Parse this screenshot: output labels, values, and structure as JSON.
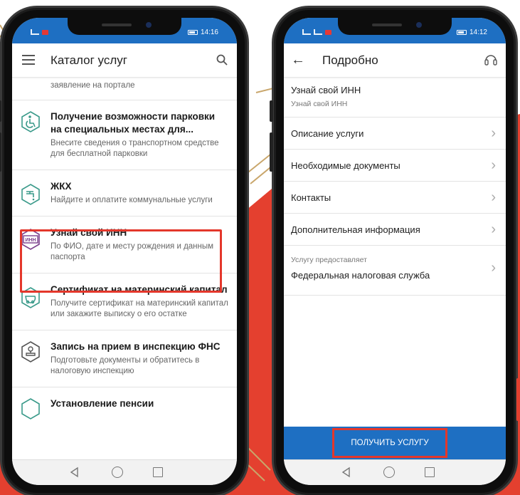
{
  "colors": {
    "accent_blue": "#1e6fc2",
    "highlight_red": "#e4372b",
    "background_red": "#e4402f",
    "gold_lines": "#c9a66b"
  },
  "left_phone": {
    "status": {
      "time": "14:16"
    },
    "appbar": {
      "title": "Каталог услуг",
      "menu_icon": "menu-icon",
      "search_icon": "search-icon"
    },
    "partial_top_text": "заявление на портале",
    "services": [
      {
        "icon": "wheelchair-icon",
        "title": "Получение возможности парковки на специальных местах для...",
        "desc": "Внесите сведения о транспортном средстве для бесплатной парковки"
      },
      {
        "icon": "faucet-icon",
        "title": "ЖКХ",
        "desc": "Найдите и оплатите коммунальные услуги"
      },
      {
        "icon": "inn-card-icon",
        "title": "Узнай свой ИНН",
        "desc": "По ФИО, дате и месту рождения и данным паспорта",
        "icon_text": "ИНН"
      },
      {
        "icon": "baby-stroller-icon",
        "title": "Сертификат на материнский капитал",
        "desc": "Получите сертификат на материнский капитал или закажите выписку о его остатке"
      },
      {
        "icon": "stamp-icon",
        "title": "Запись на прием в инспекцию ФНС",
        "desc": "Подготовьте документы и обратитесь в налоговую инспекцию"
      },
      {
        "icon": "pension-icon",
        "title": "Установление пенсии",
        "desc": ""
      }
    ]
  },
  "right_phone": {
    "status": {
      "time": "14:12"
    },
    "appbar": {
      "title": "Подробно",
      "back_icon": "back-arrow-icon",
      "support_icon": "headset-icon"
    },
    "header": {
      "title": "Узнай свой ИНН",
      "subtitle": "Узнай свой ИНН"
    },
    "rows": [
      {
        "label": "Описание услуги"
      },
      {
        "label": "Необходимые документы"
      },
      {
        "label": "Контакты"
      },
      {
        "label": "Дополнительная информация"
      }
    ],
    "provider": {
      "label": "Услугу предоставляет",
      "value": "Федеральная налоговая служба"
    },
    "cta_label": "ПОЛУЧИТЬ УСЛУГУ"
  }
}
